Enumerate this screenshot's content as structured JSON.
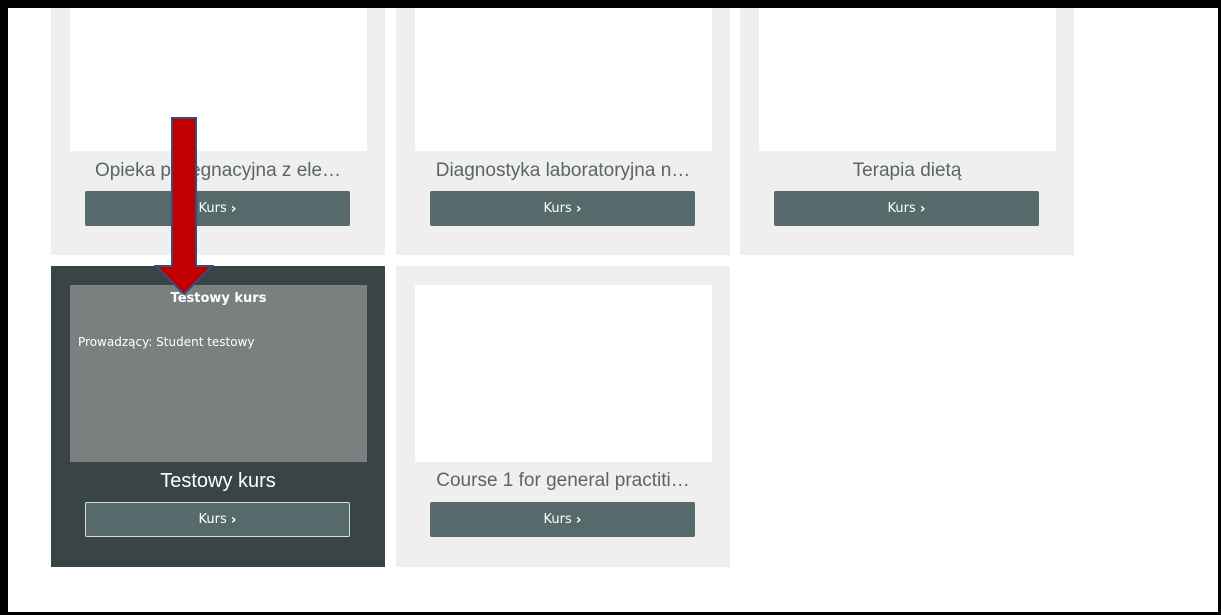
{
  "courses": [
    {
      "title": "Opieka pielęgnacyjna z ele…",
      "button": "Kurs"
    },
    {
      "title": "Diagnostyka laboratoryjna n…",
      "button": "Kurs"
    },
    {
      "title": "Terapia dietą",
      "button": "Kurs"
    },
    {
      "title": "Testowy kurs",
      "button": "Kurs",
      "thumb_title": "Testowy kurs",
      "thumb_teacher": "Prowadzący: Student testowy"
    },
    {
      "title": "Course 1 for general practiti…",
      "button": "Kurs"
    }
  ],
  "colors": {
    "card_bg": "#efefef",
    "active_card_bg": "#3a4447",
    "button_bg": "#566a6c",
    "arrow": "#c00000"
  }
}
